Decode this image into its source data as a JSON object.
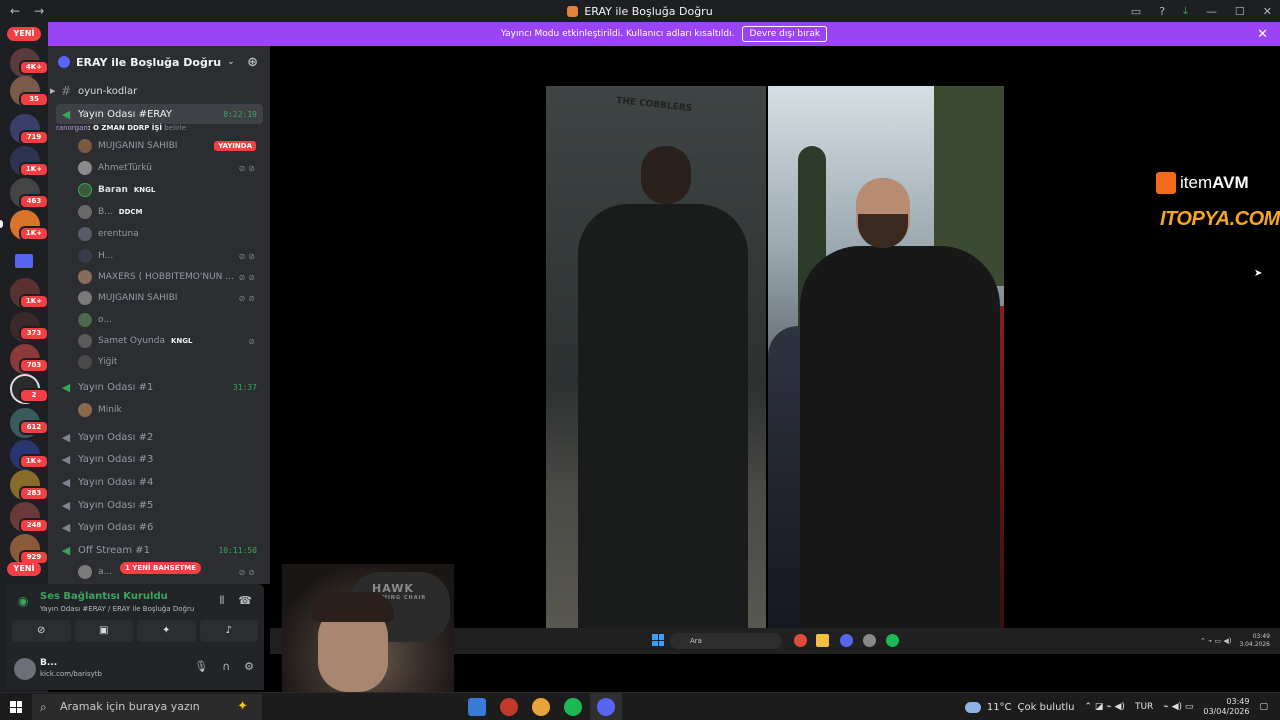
{
  "window": {
    "title": "ERAY ile Boşluğa Doğru",
    "nav_back": "←",
    "nav_forward": "→",
    "controls": [
      "▭",
      "?",
      "⤓",
      "—",
      "☐",
      "✕"
    ]
  },
  "rail": {
    "yeni_top": "YENİ",
    "yeni_bottom": "YENİ",
    "badges": [
      "4K+",
      "35",
      "719",
      "1K+",
      "463",
      "1K+",
      "1K+",
      "373",
      "703",
      "2",
      "612",
      "1K+",
      "283",
      "248",
      "929"
    ]
  },
  "banner": {
    "text": "Yayıncı Modu etkinleştirildi. Kullanıcı adları kısaltıldı.",
    "button": "Devre dışı bırak",
    "close": "✕"
  },
  "server": {
    "name": "ERAY ile Boşluğa Doğru",
    "chevron": "⌄",
    "invite_icon": "add-member-icon"
  },
  "channels": [
    {
      "name": "oyun-kodlar",
      "type": "text"
    },
    {
      "name": "Yayın Odası #ERAY",
      "type": "voice",
      "time": "8:22:19",
      "active": true
    },
    {
      "name": "Yayın Odası #1",
      "type": "voice",
      "time": "31:37"
    },
    {
      "name": "Yayın Odası #2",
      "type": "voice"
    },
    {
      "name": "Yayın Odası #3",
      "type": "voice"
    },
    {
      "name": "Yayın Odası #4",
      "type": "voice"
    },
    {
      "name": "Yayın Odası #5",
      "type": "voice"
    },
    {
      "name": "Yayın Odası #6",
      "type": "voice"
    },
    {
      "name": "Off Stream #1",
      "type": "voice",
      "time": "10:11:50"
    }
  ],
  "status_line": {
    "user": "ranorgan",
    "message": ": O ZMAN DDRP İŞİ",
    "suffix": "belirle"
  },
  "users_eray": [
    {
      "name": "MÜJGANIN SAHİBİ",
      "badge": "YAYINDA"
    },
    {
      "name": "AhmetTürkü"
    },
    {
      "name": "Baran",
      "tag": "KNGL",
      "bold": true
    },
    {
      "name": "B...",
      "tag": "DDCM",
      "tag_red": true
    },
    {
      "name": "erentuna"
    },
    {
      "name": "H..."
    },
    {
      "name": "MAXERS ( HOBBİTEMO'NUN ..."
    },
    {
      "name": "MUJGANIN SAHIBI"
    },
    {
      "name": "o..."
    },
    {
      "name": "Samet Oyunda",
      "tag": "KNGL"
    },
    {
      "name": "Yiğit"
    }
  ],
  "users_1": [
    {
      "name": "Minik"
    }
  ],
  "users_off": [
    {
      "name": "a..."
    }
  ],
  "mention_pill": "1 YENİ BAHSETME",
  "voice_panel": {
    "title": "Ses Bağlantısı Kuruldu",
    "subtitle": "Yayın Odası #ERAY / ERAY ile Boşluğa Doğru"
  },
  "user_panel": {
    "name": "B...",
    "status": "kick.com/barisytb"
  },
  "stream": {
    "sign": "THE COBBLERS",
    "sponsor1_item": "item",
    "sponsor1_avm": "AVM",
    "sponsor2": "ITOPYA.COM"
  },
  "inner_taskbar": {
    "search": "Ara",
    "time": "03:49",
    "date": "3.04.2026"
  },
  "webcam": {
    "brand": "HAWK",
    "brand_sub": "GAMING CHAIR"
  },
  "taskbar": {
    "search_placeholder": "Aramak için buraya yazın",
    "temperature": "11°C",
    "weather": "Çok bulutlu",
    "language": "TUR",
    "time": "03:49",
    "date": "03/04/2026"
  },
  "colors": {
    "accent": "#9b44f5",
    "live": "#3ba55d",
    "badge": "#f23f43"
  }
}
